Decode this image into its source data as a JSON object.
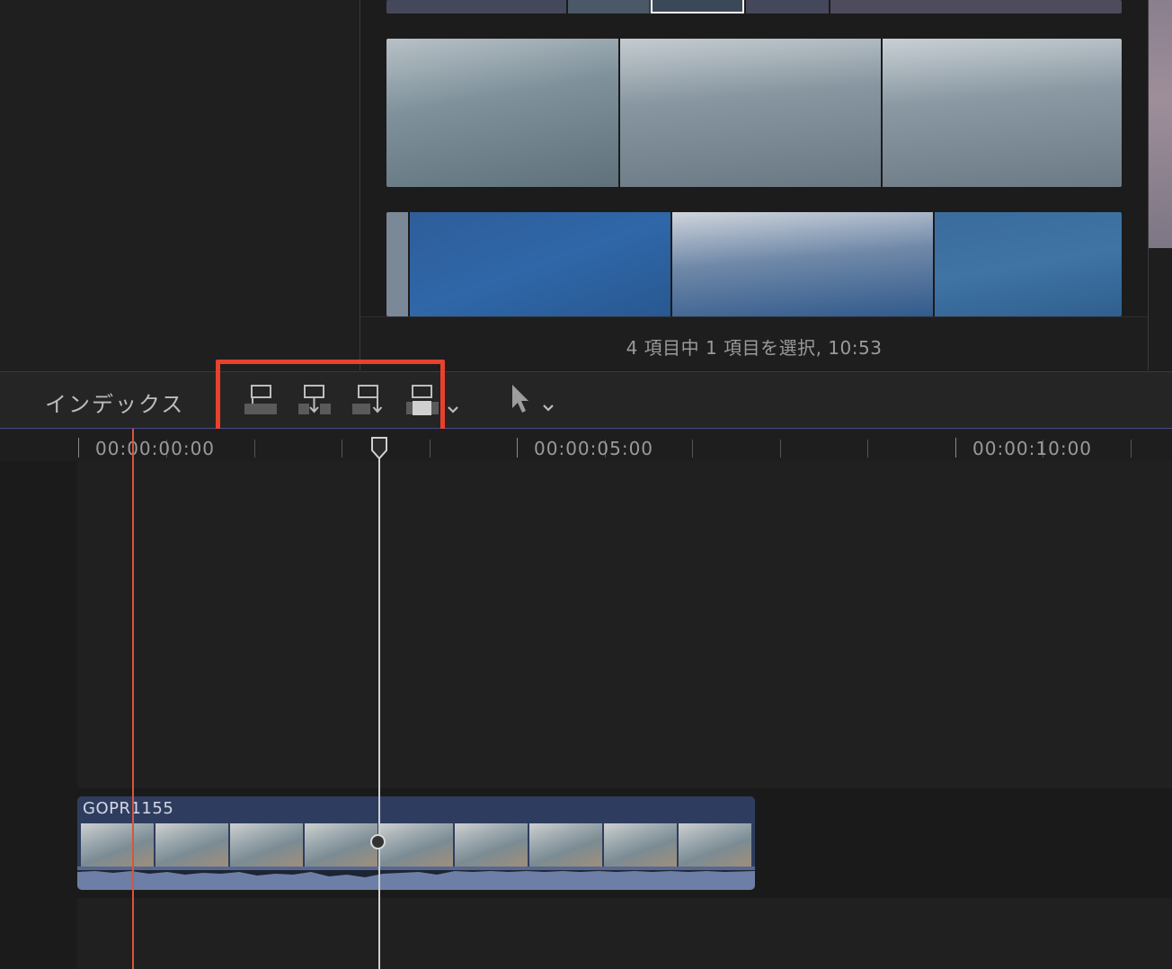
{
  "browser": {
    "status": "4 項目中 1 項目を選択, 10:53"
  },
  "toolbar": {
    "index_label": "インデックス",
    "edit_buttons": [
      {
        "name": "connect-clip-button",
        "icon": "connect-icon"
      },
      {
        "name": "insert-clip-button",
        "icon": "insert-icon"
      },
      {
        "name": "append-clip-button",
        "icon": "append-icon"
      },
      {
        "name": "overwrite-clip-button",
        "icon": "overwrite-icon"
      }
    ],
    "edit_menu_chevron": "chevron-down-icon",
    "tool_icon": "arrow-select-icon"
  },
  "ruler": {
    "timecodes": [
      "00:00:00:00",
      "00:00:05:00",
      "00:00:10:00"
    ]
  },
  "timeline": {
    "clip_name": "GOPR1155"
  },
  "colors": {
    "highlight": "#e8412c",
    "skimmer": "#d9553a",
    "clip": "#2e3d5f",
    "audio": "#6d7fa6"
  }
}
